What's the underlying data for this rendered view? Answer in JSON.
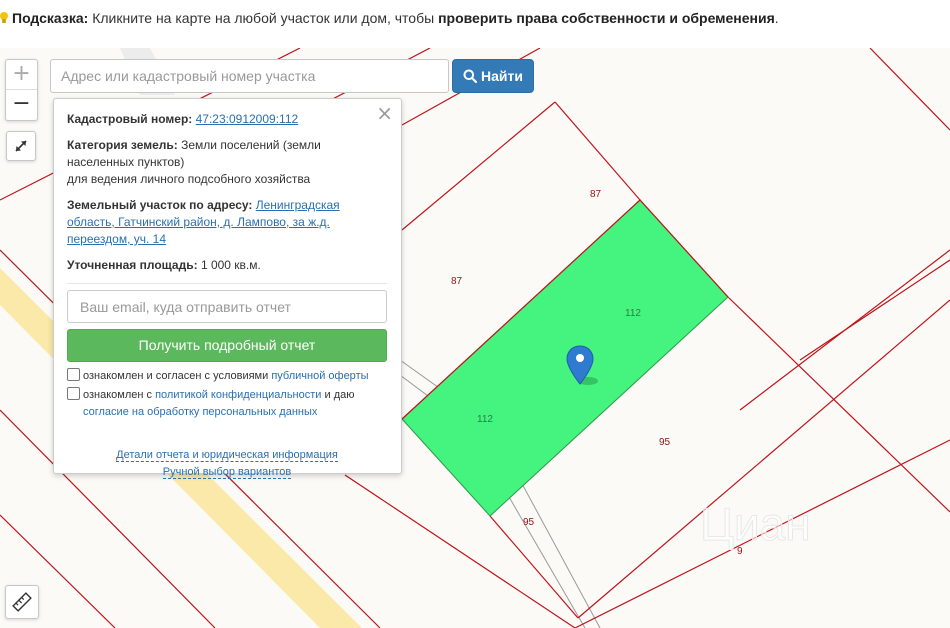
{
  "hint": {
    "label": "Подсказка:",
    "text": "Кликните на карте на любой участок или дом, чтобы",
    "bold": "проверить права собственности и обременения",
    "end": "."
  },
  "search": {
    "placeholder": "Адрес или кадастровый номер участка",
    "button_label": "Найти"
  },
  "zoom": {
    "plus": "+",
    "minus": "−"
  },
  "popup": {
    "close": "×",
    "cadastral_label": "Кадастровый номер:",
    "cadastral_value": "47:23:0912009:112",
    "category_label": "Категория земель:",
    "category_value": "Земли поселений (земли населенных пунктов)",
    "category_use": "для ведения личного подсобного хозяйства",
    "address_label": "Земельный участок по адресу:",
    "address_value": "Ленинградская область, Гатчинский район, д. Лампово, за ж.д. переездом, уч. 14",
    "area_label": "Уточненная площадь:",
    "area_value": "1 000 кв.м.",
    "email_placeholder": "Ваш email, куда отправить отчет",
    "report_button": "Получить подробный отчет",
    "agree1_prefix": "ознакомлен и согласен с условиями",
    "agree1_link": "публичной оферты",
    "agree2_prefix": "ознакомлен с",
    "agree2_link": "политикой конфиденциальности",
    "agree2_mid": "и даю",
    "agree2_link2": "согласие на обработку персональных данных",
    "details_link": "Детали отчета и юридическая информация",
    "manual_link": "Ручной выбор вариантов"
  },
  "map": {
    "labels": [
      "87",
      "87",
      "112",
      "112",
      "95",
      "95",
      "9"
    ],
    "watermark": "Циан",
    "parcel_color": "#44f47f",
    "boundary_color": "#c0131b",
    "road_color": "#fbe9a9"
  }
}
